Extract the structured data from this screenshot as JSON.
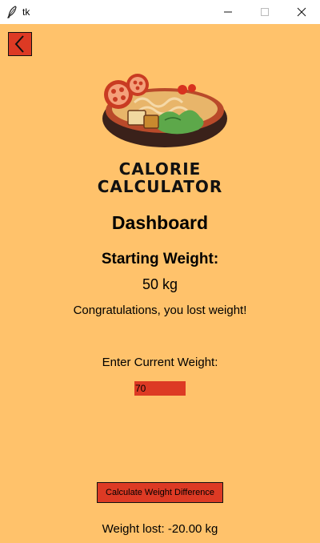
{
  "window": {
    "title": "tk"
  },
  "branding": {
    "line1": "CALORIE",
    "line2": "CALCULATOR"
  },
  "dashboard": {
    "heading": "Dashboard",
    "starting_weight_label": "Starting Weight:",
    "starting_weight_value": "50 kg",
    "status_message": "Congratulations, you lost weight!",
    "current_weight_label": "Enter Current Weight:",
    "current_weight_value": "70",
    "calculate_button_label": "Calculate Weight Difference",
    "result_text": "Weight lost: -20.00 kg"
  },
  "colors": {
    "background": "#ffc26b",
    "accent": "#dd3a24"
  },
  "icons": {
    "back": "chevron-left-icon",
    "logo": "food-bowl-icon"
  }
}
